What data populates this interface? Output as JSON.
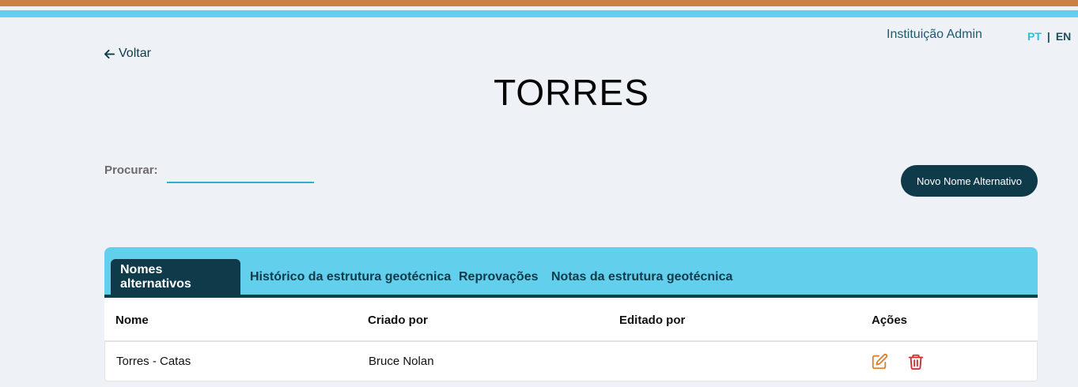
{
  "header": {
    "user": "Instituição Admin",
    "lang_pt": "PT",
    "lang_separator": "|",
    "lang_en": "EN"
  },
  "nav": {
    "back_label": "Voltar"
  },
  "page": {
    "title": "TORRES"
  },
  "search": {
    "label": "Procurar:",
    "value": "",
    "placeholder": ""
  },
  "actions": {
    "new_button_label": "Novo Nome Alternativo"
  },
  "tabs": [
    {
      "label": "Nomes alternativos",
      "active": true
    },
    {
      "label": "Histórico da estrutura geotécnica",
      "active": false
    },
    {
      "label": "Reprovações",
      "active": false
    },
    {
      "label": "Notas da estrutura geotécnica",
      "active": false
    }
  ],
  "table": {
    "columns": [
      "Nome",
      "Criado por",
      "Editado por",
      "Ações"
    ],
    "rows": [
      {
        "nome": "Torres - Catas",
        "criado_por": "Bruce Nolan",
        "editado_por": ""
      }
    ]
  },
  "colors": {
    "primary_dark": "#0e3a4a",
    "accent_blue": "#62d0ec",
    "accent_orange": "#c98244",
    "edit_icon": "#d9822b",
    "delete_icon": "#d22b2b"
  }
}
